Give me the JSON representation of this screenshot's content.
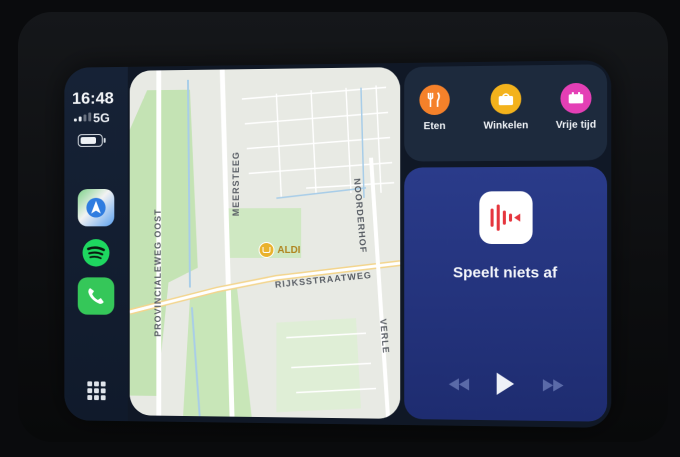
{
  "status": {
    "time": "16:48",
    "network": "5G"
  },
  "dock": {
    "apps": [
      "maps-app",
      "spotify-app",
      "phone-app",
      "app-grid"
    ]
  },
  "map": {
    "streets": {
      "provincialeweg": "PROVINCIALEWEG OOST",
      "meersteeg": "MEERSTEEG",
      "rijksstraatweg": "RIJKSSTRAATWEG",
      "noorderhof": "NOORDERHOF",
      "verlengde": "VERLE"
    },
    "poi": "ALDI"
  },
  "categories": [
    {
      "label": "Eten",
      "color": "#f5812a",
      "icon": "fork-knife-icon"
    },
    {
      "label": "Winkelen",
      "color": "#f3b21c",
      "icon": "shopping-icon"
    },
    {
      "label": "Vrije tijd",
      "color": "#e43fb5",
      "icon": "leisure-icon"
    }
  ],
  "now_playing": {
    "status": "Speelt niets af",
    "app_icon": "podcast-app-icon",
    "accent": "#e5363e"
  },
  "colors": {
    "screen_bg": "#101826",
    "player_bg": "#2a3b8a"
  }
}
